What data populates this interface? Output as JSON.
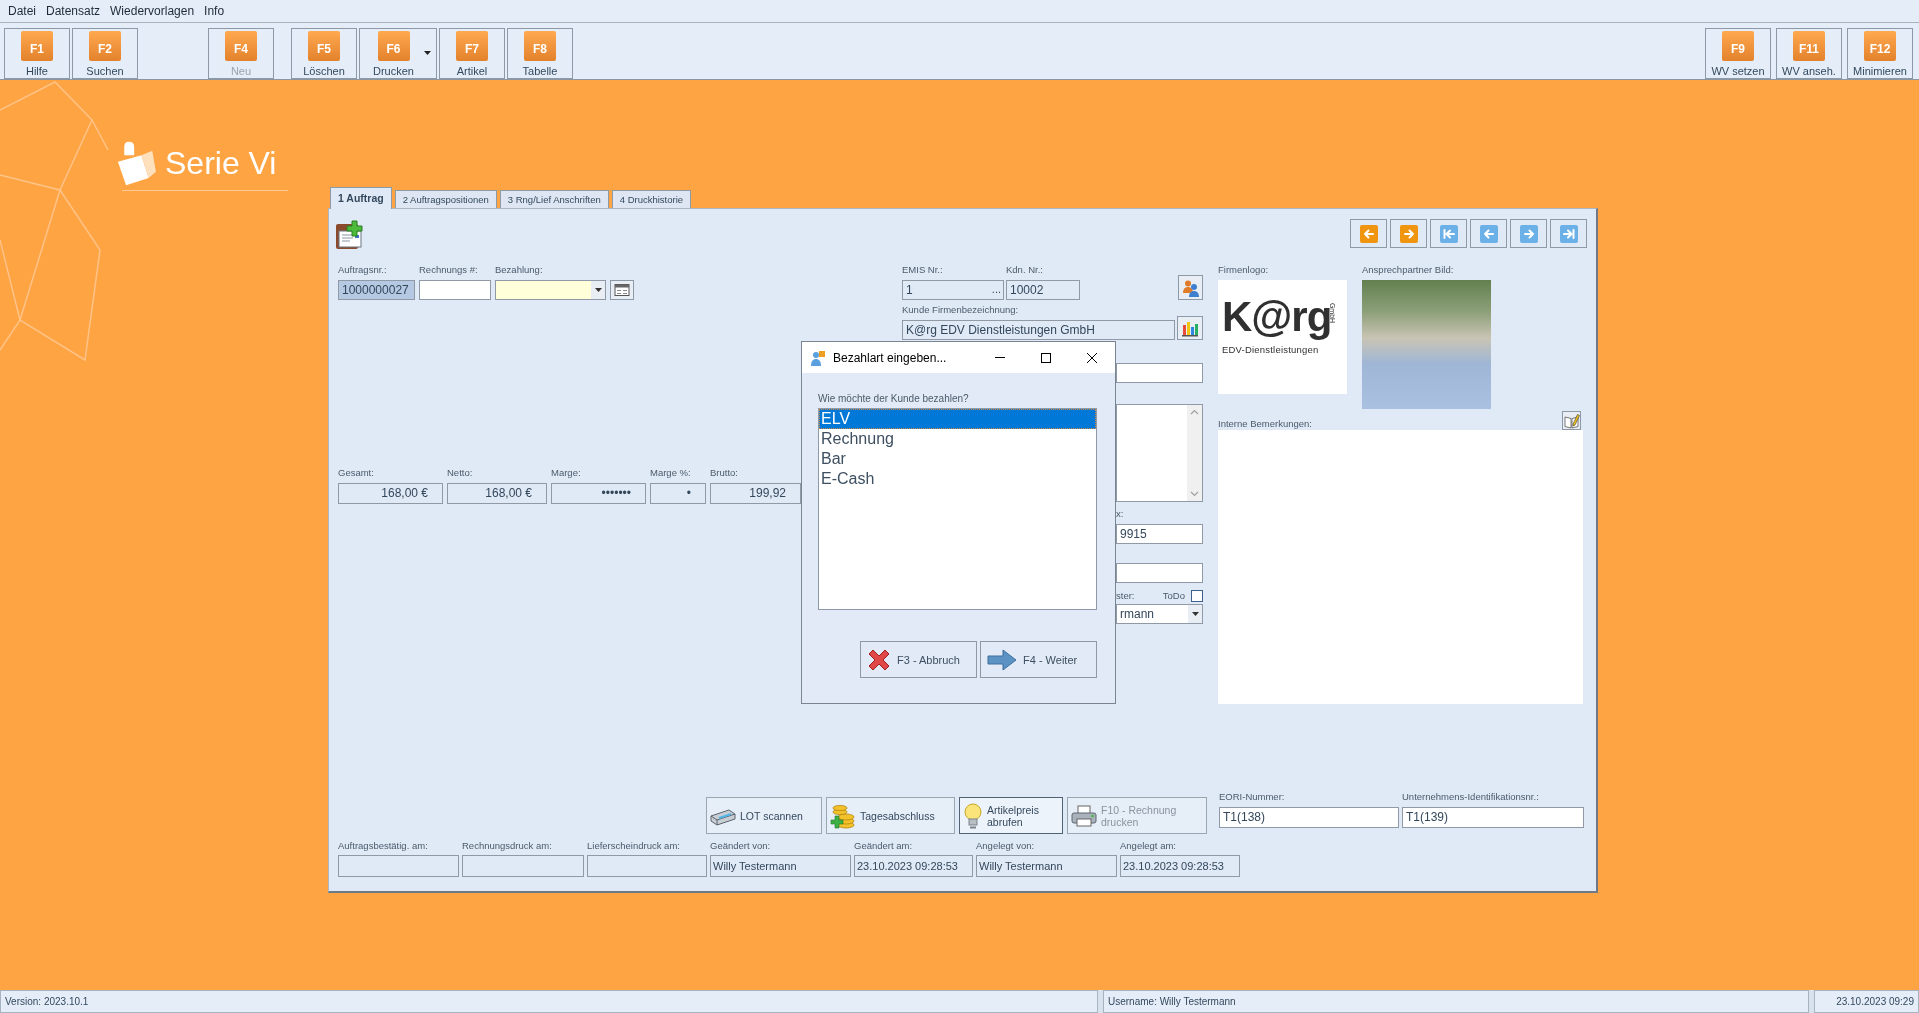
{
  "menu": [
    {
      "label": "Datei"
    },
    {
      "label": "Datensatz"
    },
    {
      "label": "Wiedervorlagen"
    },
    {
      "label": "Info"
    }
  ],
  "toolbar": {
    "left_groups": [
      [
        {
          "key": "F1",
          "label": "Hilfe",
          "disabled": false,
          "dropdown": false
        },
        {
          "key": "F2",
          "label": "Suchen",
          "disabled": false,
          "dropdown": false
        }
      ],
      [
        {
          "key": "F4",
          "label": "Neu",
          "disabled": true,
          "dropdown": false
        }
      ],
      [
        {
          "key": "F5",
          "label": "Löschen",
          "disabled": false,
          "dropdown": false
        },
        {
          "key": "F6",
          "label": "Drucken",
          "disabled": false,
          "dropdown": true
        },
        {
          "key": "F7",
          "label": "Artikel",
          "disabled": false,
          "dropdown": false
        },
        {
          "key": "F8",
          "label": "Tabelle",
          "disabled": false,
          "dropdown": false
        }
      ]
    ],
    "right": [
      {
        "key": "F9",
        "label": "WV setzen",
        "disabled": false,
        "dropdown": false
      },
      {
        "key": "F11",
        "label": "WV anseh.",
        "disabled": false,
        "dropdown": false
      },
      {
        "key": "F12",
        "label": "Minimieren",
        "disabled": false,
        "dropdown": false
      }
    ]
  },
  "brand": {
    "name": "Serie Vi"
  },
  "tabs": [
    {
      "label": "1 Auftrag",
      "selected": true
    },
    {
      "label": "2 Auftragspositionen",
      "selected": false
    },
    {
      "label": "3 Rng/Lief Anschriften",
      "selected": false
    },
    {
      "label": "4 Druckhistorie",
      "selected": false
    }
  ],
  "order": {
    "header_fields": [
      {
        "label": "Auftragsnr.:",
        "value": "1000000027",
        "kind": "selected"
      },
      {
        "label": "Rechnungs #:",
        "kind": "input"
      },
      {
        "label": "Bezahlung:",
        "kind": "combo"
      },
      {
        "kind": "button"
      }
    ],
    "totals": [
      {
        "label": "Gesamt:",
        "value": "168,00 €"
      },
      {
        "label": "Netto:",
        "value": "168,00 €"
      },
      {
        "label": "Marge:",
        "value": "•••••••"
      },
      {
        "label": "Marge %:",
        "value": "•"
      },
      {
        "label": "Brutto:",
        "value": "199,92"
      }
    ],
    "customer": {
      "emis": {
        "label": "EMIS Nr.:",
        "value": "1",
        "lookup": "..."
      },
      "number": {
        "label": "Kdn. Nr.:",
        "value": "10002"
      },
      "company": {
        "label": "Kunde Firmenbezeichnung:",
        "value": "K@rg EDV Dienstleistungen GmbH"
      }
    },
    "covered_fields": [
      {
        "kind": "input"
      },
      {
        "kind": "memo"
      },
      {
        "kind": "input",
        "label": "x:",
        "value": "9915"
      },
      {
        "kind": "input"
      },
      {
        "kind": "combo",
        "label": "ster:",
        "value": "rmann",
        "todo": {
          "label": "ToDo",
          "checked": false
        }
      }
    ],
    "logo": {
      "label": "Firmenlogo:",
      "wordmark": "K@rg",
      "suffix": "GmbH",
      "tagline": "EDV-Dienstleistungen"
    },
    "contact_photo": {
      "label": "Ansprechpartner Bild:"
    },
    "notes": {
      "label": "Interne Bemerkungen:"
    },
    "actions": [
      {
        "label": "LOT scannen",
        "kind": "scan",
        "disabled": false,
        "highlighted": false
      },
      {
        "label": "Tagesabschluss",
        "kind": "closing",
        "disabled": false,
        "highlighted": false
      },
      {
        "label": "Artikelpreis abrufen",
        "kind": "price",
        "disabled": false,
        "highlighted": true
      },
      {
        "label": "F10 - Rechnung drucken",
        "kind": "print",
        "disabled": true,
        "highlighted": false
      }
    ],
    "ids": [
      {
        "label": "EORI-Nummer:",
        "value": "T1(138)"
      },
      {
        "label": "Unternehmens-Identifikationsnr.:",
        "value": "T1(139)"
      }
    ],
    "audit": [
      {
        "label": "Auftragsbestätig. am:"
      },
      {
        "label": "Rechnungsdruck am:"
      },
      {
        "label": "Lieferscheindruck am:"
      },
      {
        "label": "Geändert von:",
        "value": "Willy Testermann"
      },
      {
        "label": "Geändert am:",
        "value": "23.10.2023 09:28:53"
      },
      {
        "label": "Angelegt von:",
        "value": "Willy Testermann"
      },
      {
        "label": "Angelegt am:",
        "value": "23.10.2023 09:28:53"
      }
    ]
  },
  "dialog": {
    "title": "Bezahlart eingeben...",
    "prompt": "Wie möchte der Kunde bezahlen?",
    "options": [
      {
        "label": "ELV",
        "selected": true
      },
      {
        "label": "Rechnung",
        "selected": false
      },
      {
        "label": "Bar",
        "selected": false
      },
      {
        "label": "E-Cash",
        "selected": false
      }
    ],
    "buttons": [
      {
        "label": "F3 - Abbruch",
        "kind": "cancel"
      },
      {
        "label": "F4 - Weiter",
        "kind": "next"
      }
    ]
  },
  "status_bar": {
    "version": "Version: 2023.10.1",
    "user": "Username: Willy Testermann",
    "datetime": "23.10.2023 09:29"
  }
}
